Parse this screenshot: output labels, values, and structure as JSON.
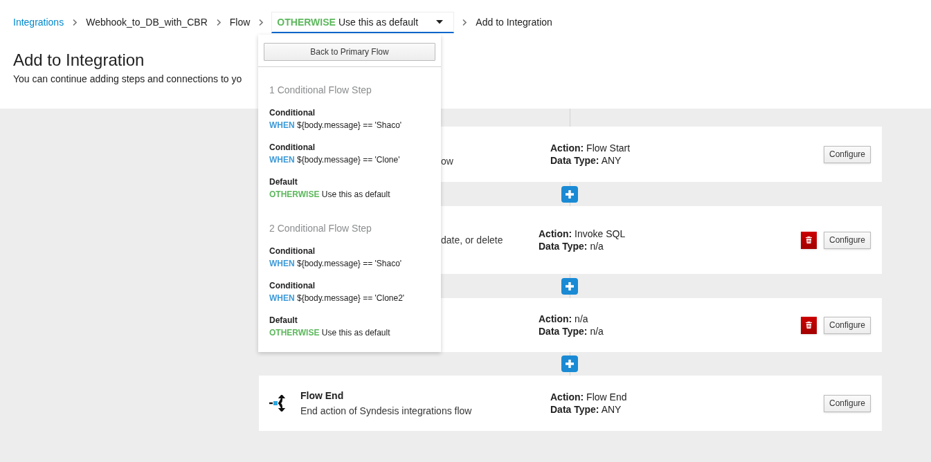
{
  "breadcrumb": {
    "items": [
      {
        "label": "Integrations",
        "link": true
      },
      {
        "label": "Webhook_to_DB_with_CBR",
        "link": false
      },
      {
        "label": "Flow",
        "link": false
      }
    ],
    "flow_select": {
      "keyword": "OTHERWISE",
      "label": "Use this as default",
      "expanded": true
    },
    "last": "Add to Integration"
  },
  "header": {
    "title": "Add to Integration",
    "description": "You can continue adding steps and connections to yo"
  },
  "dropdown": {
    "back_button": "Back to Primary Flow",
    "groups": [
      {
        "title": "1 Conditional Flow Step",
        "items": [
          {
            "name": "Conditional",
            "kind": "when",
            "keyword": "WHEN",
            "condition": "${body.message} == 'Shaco'"
          },
          {
            "name": "Conditional",
            "kind": "when",
            "keyword": "WHEN",
            "condition": "${body.message} == 'Clone'"
          },
          {
            "name": "Default",
            "kind": "otherwise",
            "keyword": "OTHERWISE",
            "condition": "Use this as default"
          }
        ]
      },
      {
        "title": "2 Conditional Flow Step",
        "items": [
          {
            "name": "Conditional",
            "kind": "when",
            "keyword": "WHEN",
            "condition": "${body.message} == 'Shaco'"
          },
          {
            "name": "Conditional",
            "kind": "when",
            "keyword": "WHEN",
            "condition": "${body.message} == 'Clone2'"
          },
          {
            "name": "Default",
            "kind": "otherwise",
            "keyword": "OTHERWISE",
            "condition": "Use this as default"
          }
        ]
      }
    ]
  },
  "steps": [
    {
      "description": "ow",
      "action_label": "Action:",
      "action": "Flow Start",
      "data_type_label": "Data Type:",
      "data_type": "ANY",
      "deletable": false,
      "configure": "Configure"
    },
    {
      "description": "date, or delete",
      "action_label": "Action:",
      "action": "Invoke SQL",
      "data_type_label": "Data Type:",
      "data_type": "n/a",
      "deletable": true,
      "configure": "Configure"
    },
    {
      "action_label": "Action:",
      "action": "n/a",
      "data_type_label": "Data Type:",
      "data_type": "n/a",
      "deletable": true,
      "configure": "Configure"
    },
    {
      "title": "Flow End",
      "description": "End action of Syndesis integrations flow",
      "action_label": "Action:",
      "action": "Flow End",
      "data_type_label": "Data Type:",
      "data_type": "ANY",
      "deletable": false,
      "icon": true,
      "configure": "Configure"
    }
  ]
}
